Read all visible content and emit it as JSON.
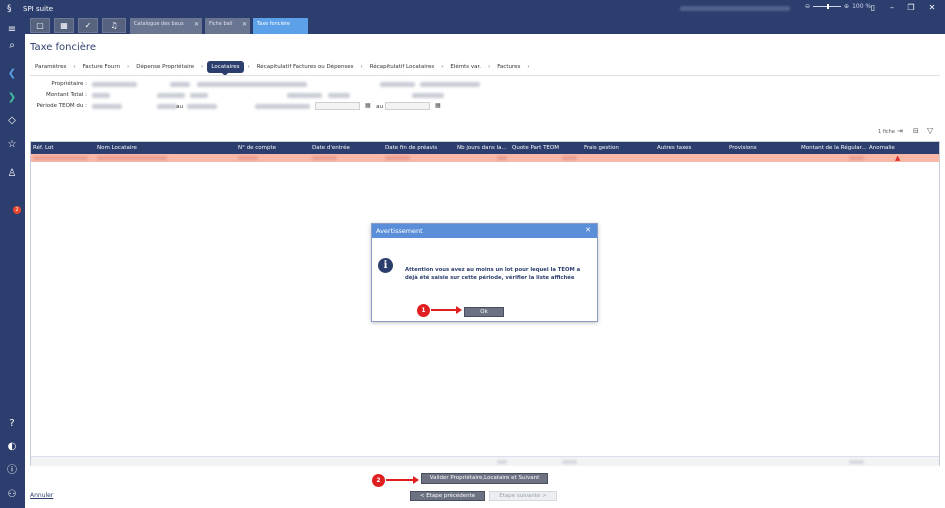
{
  "window": {
    "title": "SPI suite",
    "zoom": "100 %"
  },
  "tabs": [
    {
      "label": "Catalogue des baux",
      "active": false
    },
    {
      "label": "Fiche bail",
      "active": false
    },
    {
      "label": "Taxe foncière",
      "active": true
    }
  ],
  "page": {
    "title": "Taxe foncière"
  },
  "breadcrumb": [
    "Paramètres",
    "Facture Fourn",
    "Dépense Propriétaire",
    "Locataires",
    "Récapitulatif Factures ou Dépenses",
    "Récapitulatif Locataires",
    "Elémts var.",
    "Factures"
  ],
  "breadcrumb_active": "Locataires",
  "form": {
    "proprietaire_label": "Propriétaire :",
    "montant_label": "Montant Total :",
    "periode_label": "Période TEOM du :",
    "au_label": "au",
    "au_label2": "au"
  },
  "grid": {
    "record_count": "1 fiche",
    "columns": [
      "Réf. Lot",
      "Nom Locataire",
      "N° de compte",
      "Date d'entrée",
      "Date fin de préavis",
      "Nb jours dans la...",
      "Quote Part TEOM",
      "Frais gestion",
      "Autres taxes",
      "Provisions",
      "Montant de la Régular...",
      "Anomalie"
    ]
  },
  "dialog": {
    "title": "Avertissement",
    "message": "Attention vous avez au moins un lot pour lequel la TEOM a déjà été saisie sur cette période, vérifier la liste affichée",
    "ok_label": "Ok"
  },
  "markers": [
    "1",
    "2"
  ],
  "buttons": {
    "valider": "Valider Propriétaire,Locataire et Suivant",
    "prev": "< Etape précédente",
    "next": "Etape suivante >",
    "annuler": "Annuler"
  },
  "colors": {
    "primary": "#2c3e6e",
    "accent": "#5ba0e8",
    "warning_row": "#f8b8a8",
    "marker": "#e02020"
  }
}
